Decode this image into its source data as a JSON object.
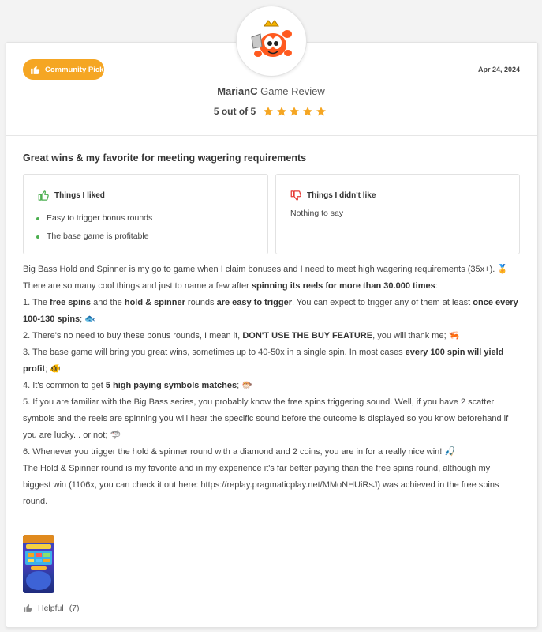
{
  "review": {
    "badge_label": "Community Pick",
    "date": "Apr 24, 2024",
    "reviewer_name": "MarianC",
    "reviewer_suffix": "Game Review",
    "rating_text": "5 out of 5",
    "rating_value": 5,
    "rating_max": 5,
    "headline": "Great wins & my favorite for meeting wagering requirements",
    "liked": {
      "title": "Things I liked",
      "items": [
        "Easy to trigger bonus rounds",
        "The base game is profitable"
      ]
    },
    "disliked": {
      "title": "Things I didn't like",
      "text": "Nothing to say"
    },
    "body": {
      "p1": "Big Bass Hold and Spinner is my go to game when I claim bonuses and I need to meet high wagering requirements (35x+). 🏅",
      "p2a": "There are so many cool things and just to name a few after ",
      "p2b": "spinning its reels for more than 30.000 times",
      "p2c": ":",
      "p3a": "1. The ",
      "p3b": "free spins",
      "p3c": " and the ",
      "p3d": "hold & spinner",
      "p3e": " rounds ",
      "p3f": "are easy to trigger",
      "p3g": ". You can expect to trigger any of them at least ",
      "p3h": "once every 100-130 spins",
      "p3i": "; 🐟",
      "p4a": "2. There's no need to buy these bonus rounds, I mean it, ",
      "p4b": "DON'T USE THE BUY FEATURE",
      "p4c": ", you will thank me; 🦐",
      "p5a": "3. The base game will bring you great wins, sometimes up to 40-50x in a single spin. In most cases ",
      "p5b": "every 100 spin will yield profit",
      "p5c": "; 🐠",
      "p6a": "4. It's common to get ",
      "p6b": "5 high paying symbols matches",
      "p6c": "; 🐡",
      "p7": "5. If you are familiar with the Big Bass series, you probably know the free spins triggering sound. Well, if you have 2 scatter symbols and the reels are spinning you will hear the specific sound before the outcome is displayed so you know beforehand if you are lucky... or not; 🦈",
      "p8": "6. Whenever you trigger the hold & spinner round with a diamond and 2 coins, you are in for a really nice win! 🎣",
      "p9": "The Hold & Spinner round is my favorite and in my experience it's far better paying than the free spins round, although my biggest win (1106x, you can check it out here: https://replay.pragmaticplay.net/MMoNHUiRsJ) was achieved in the free spins round."
    },
    "helpful_label": "Helpful",
    "helpful_count": "(7)"
  },
  "icons": {
    "badge": "thumbs-up-icon",
    "liked": "thumbs-up-outline-icon",
    "disliked": "thumbs-down-outline-icon",
    "helpful": "thumbs-up-icon",
    "star": "star-icon"
  },
  "colors": {
    "badge_bg": "#f5a623",
    "star": "#f5a623",
    "liked_icon": "#4caf50",
    "disliked_icon": "#e53935",
    "bullet": "#4caf50"
  }
}
